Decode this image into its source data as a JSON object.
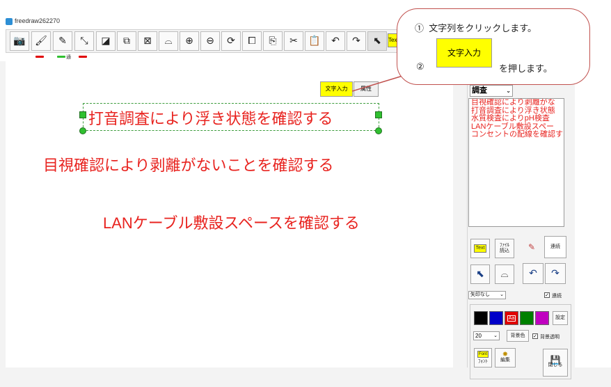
{
  "window": {
    "title": "freedraw262270"
  },
  "toolbar": {
    "buttons": [
      {
        "name": "camera-icon",
        "glyph": "📷"
      },
      {
        "name": "brush-icon",
        "glyph": "🖌"
      },
      {
        "name": "pencil-icon",
        "glyph": "✎"
      },
      {
        "name": "arrow-resize-icon",
        "glyph": "⤡"
      },
      {
        "name": "shape-select-icon",
        "glyph": "◪"
      },
      {
        "name": "multi-select-icon",
        "glyph": "⧉"
      },
      {
        "name": "delete-shape-icon",
        "glyph": "⊠"
      },
      {
        "name": "lasso-icon",
        "glyph": "⌓"
      },
      {
        "name": "zoom-in-icon",
        "glyph": "⊕"
      },
      {
        "name": "zoom-out-icon",
        "glyph": "⊖"
      },
      {
        "name": "zoom-reset-icon",
        "glyph": "⟳"
      },
      {
        "name": "copy-icon",
        "glyph": "⧠"
      },
      {
        "name": "paste-icon",
        "glyph": "⎘"
      },
      {
        "name": "cut-icon",
        "glyph": "✂"
      },
      {
        "name": "clipboard-icon",
        "glyph": "📋"
      },
      {
        "name": "undo-icon",
        "glyph": "↶"
      },
      {
        "name": "redo-icon",
        "glyph": "↷"
      },
      {
        "name": "pointer-icon",
        "glyph": "⬉"
      }
    ],
    "pen_width_label": "通",
    "text_button_label": "Text"
  },
  "canvas": {
    "selected_text": "打音調査により浮き状態を確認する",
    "text2": "目視確認により剥離がないことを確認する",
    "text3": "LANケーブル敷設スペースを確認する",
    "text_input_button": "文字入力",
    "attribute_button": "属性"
  },
  "callout": {
    "step1_num": "①",
    "step1_text": "文字列をクリックします。",
    "step2_num": "②",
    "button_label": "文字入力",
    "step2_text": "を押します。"
  },
  "right_panel": {
    "combo_value": "調査",
    "strings": [
      "目視確認により剥離がな",
      "打音調査により浮き状態",
      "水質検査によりpH検査",
      "LANケーブル敷設スペー",
      "コンセントの配線を確認す"
    ],
    "text_btn": "Text",
    "file_btn_line1": "ﾌｧｲﾙ",
    "file_btn_line2": "読込",
    "renzoku_btn": "連続",
    "arrow_combo": "矢印なし",
    "renzoku_check_label": "連続",
    "swatch_label": "Aa",
    "settings_btn": "設定",
    "size_value": "20",
    "bg_color_btn": "背景色",
    "transparent_label": "背景透明",
    "font_btn": "ﾌｫﾝﾄ",
    "font_icon_label": "Font",
    "edit_btn": "編集",
    "close_btn": "閉じる",
    "colors": [
      "#000000",
      "#0000c8",
      "#e00000",
      "#008000",
      "#c000c0"
    ]
  }
}
